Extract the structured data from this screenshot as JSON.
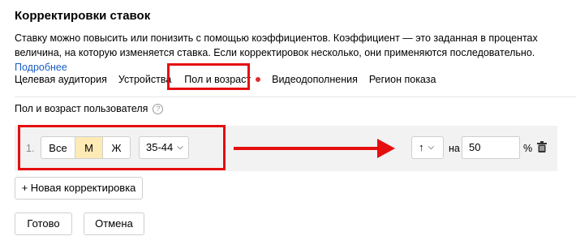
{
  "dialog": {
    "title": "Корректировки ставок",
    "description": "Ставку можно повысить или понизить с помощью коэффициентов. Коэффициент — это заданная в процентах величина, на которую изменяется ставка. Если корректировок несколько, они применяются последовательно.",
    "more_link": "Подробнее"
  },
  "tabs": [
    {
      "label": "Целевая аудитория",
      "active": false
    },
    {
      "label": "Устройства",
      "active": false
    },
    {
      "label": "Пол и возраст",
      "active": true
    },
    {
      "label": "Видеодополнения",
      "active": false
    },
    {
      "label": "Регион показа",
      "active": false
    }
  ],
  "section": {
    "title": "Пол и возраст пользователя",
    "help_icon": "?"
  },
  "rule": {
    "number": "1.",
    "gender_options": [
      "Все",
      "М",
      "Ж"
    ],
    "gender_selected": "М",
    "age_value": "35-44",
    "direction_icon": "↑",
    "na_label": "на",
    "value": "50",
    "unit": "%"
  },
  "buttons": {
    "add_label": "+ Новая корректировка",
    "done_label": "Готово",
    "cancel_label": "Отмена"
  },
  "colors": {
    "accent_red": "#e50f0f",
    "selected_seg": "#fdeab5",
    "link": "#1a5ec4",
    "row_bg": "#f2f2f2",
    "tab_dot": "#e02d2d"
  },
  "icons": {
    "chevron": "chevron-down-icon",
    "trash": "trash-icon"
  }
}
